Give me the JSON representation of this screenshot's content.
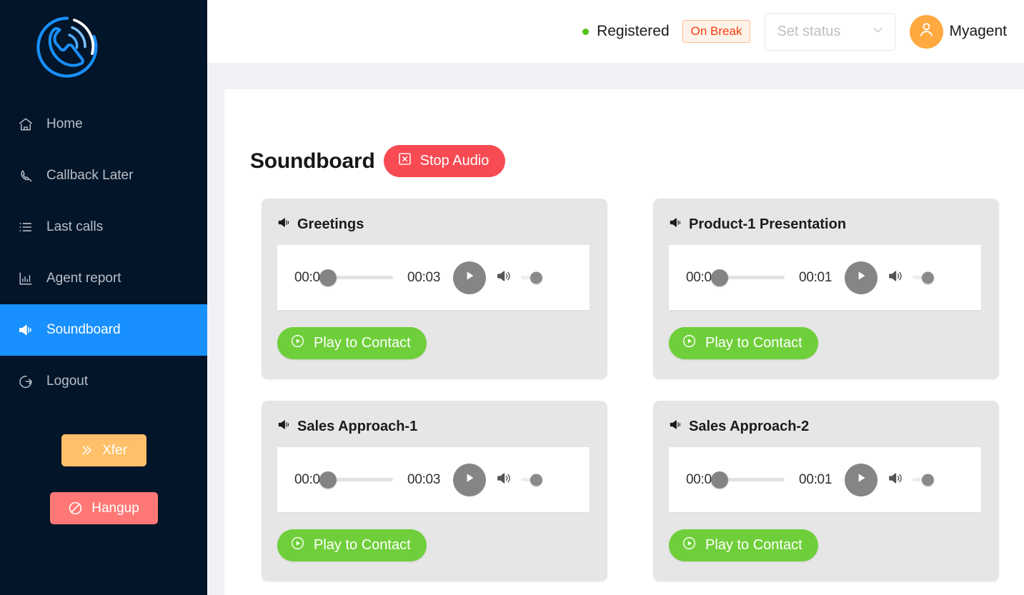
{
  "brand": {
    "logo_icon": "phone-waves-logo",
    "logo_ring_color": "#1890ff",
    "logo_wave_color": "#ffffff"
  },
  "sidebar": {
    "bg_color": "#021529",
    "active_color": "#1890ff",
    "items": [
      {
        "label": "Home",
        "icon": "home-icon",
        "active": false
      },
      {
        "label": "Callback Later",
        "icon": "phone-icon",
        "active": false
      },
      {
        "label": "Last calls",
        "icon": "list-icon",
        "active": false
      },
      {
        "label": "Agent report",
        "icon": "bar-chart-icon",
        "active": false
      },
      {
        "label": "Soundboard",
        "icon": "sound-icon",
        "active": true
      },
      {
        "label": "Logout",
        "icon": "logout-icon",
        "active": false
      }
    ],
    "actions": {
      "xfer_label": "Xfer",
      "xfer_icon": "double-right-icon",
      "xfer_color": "#ffc069",
      "hangup_label": "Hangup",
      "hangup_icon": "stop-circle-icon",
      "hangup_color": "#ff7875"
    }
  },
  "header": {
    "registration_status": "Registered",
    "registration_dot_color": "#52c41a",
    "break_tag": "On Break",
    "break_tag_color": "#fa3c10",
    "status_select_placeholder": "Set status",
    "status_select_icon": "chevron-down-icon",
    "avatar_icon": "user-icon",
    "avatar_color": "#ffa940",
    "agent_name": "Myagent"
  },
  "page": {
    "title": "Soundboard",
    "stop_audio_label": "Stop Audio",
    "stop_audio_icon": "close-square-icon",
    "stop_audio_color": "#f84a53"
  },
  "cards": [
    {
      "title": "Greetings",
      "icon": "sound-icon",
      "current_time": "00:00",
      "duration": "00:03",
      "progress_pct": 0,
      "volume_pct": 100,
      "play_icon": "play-icon",
      "volume_icon": "speaker-icon",
      "play_to_contact_label": "Play to Contact",
      "play_to_contact_icon": "play-circle-icon"
    },
    {
      "title": "Product-1 Presentation",
      "icon": "sound-icon",
      "current_time": "00:00",
      "duration": "00:01",
      "progress_pct": 0,
      "volume_pct": 100,
      "play_icon": "play-icon",
      "volume_icon": "speaker-icon",
      "play_to_contact_label": "Play to Contact",
      "play_to_contact_icon": "play-circle-icon"
    },
    {
      "title": "Sales Approach-1",
      "icon": "sound-icon",
      "current_time": "00:00",
      "duration": "00:03",
      "progress_pct": 0,
      "volume_pct": 100,
      "play_icon": "play-icon",
      "volume_icon": "speaker-icon",
      "play_to_contact_label": "Play to Contact",
      "play_to_contact_icon": "play-circle-icon"
    },
    {
      "title": "Sales Approach-2",
      "icon": "sound-icon",
      "current_time": "00:00",
      "duration": "00:01",
      "progress_pct": 0,
      "volume_pct": 100,
      "play_icon": "play-icon",
      "volume_icon": "speaker-icon",
      "play_to_contact_label": "Play to Contact",
      "play_to_contact_icon": "play-circle-icon"
    }
  ]
}
